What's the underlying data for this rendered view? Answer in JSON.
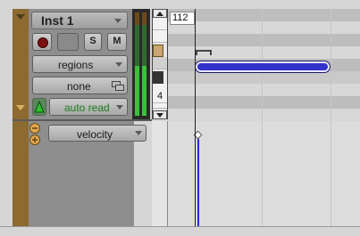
{
  "track": {
    "name": "Inst 1",
    "solo_label": "S",
    "mute_label": "M",
    "view_selector": "regions",
    "playlist_selector": "none",
    "automation_mode": "auto read"
  },
  "velocity_lane": {
    "selector": "velocity"
  },
  "piano_roll": {
    "pitch_readout": "112",
    "octave_label": "4"
  },
  "colors": {
    "track_color": "#8c6a30",
    "note_fill": "#3333cc",
    "velocity_stalk": "#2a2ad8",
    "meter_green": "#39c23a",
    "automation_green": "#1e7a1e"
  },
  "icons": {
    "collapse": "triangle-down-icon",
    "record": "record-dot-icon",
    "playlist": "playlist-icon",
    "automation": "automation-icon",
    "add_lane": "plus-circle-icon",
    "remove_lane": "minus-circle-icon"
  }
}
